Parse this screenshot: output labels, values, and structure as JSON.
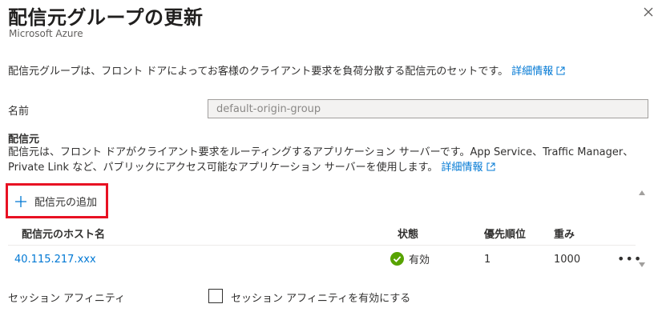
{
  "header": {
    "title": "配信元グループの更新",
    "subtitle": "Microsoft Azure"
  },
  "intro": {
    "text": "配信元グループは、フロント ドアによってお客様のクライアント要求を負荷分散する配信元のセットです。",
    "link": "詳細情報"
  },
  "name_field": {
    "label": "名前",
    "value": "default-origin-group"
  },
  "origins": {
    "heading": "配信元",
    "description": "配信元は、フロント ドアがクライアント要求をルーティングするアプリケーション サーバーです。App Service、Traffic Manager、Private Link など、パブリックにアクセス可能なアプリケーション サーバーを使用します。",
    "link": "詳細情報",
    "add_button": "配信元の追加",
    "columns": [
      "配信元のホスト名",
      "状態",
      "優先順位",
      "重み"
    ],
    "rows": [
      {
        "host": "40.115.217.xxx",
        "status": "有効",
        "priority": "1",
        "weight": "1000"
      }
    ]
  },
  "session_affinity": {
    "label": "セッション アフィニティ",
    "checkbox_label": "セッション アフィニティを有効にする",
    "checked": false
  },
  "colors": {
    "accent": "#0078d4",
    "highlight": "#e81123",
    "success": "#57a300"
  }
}
